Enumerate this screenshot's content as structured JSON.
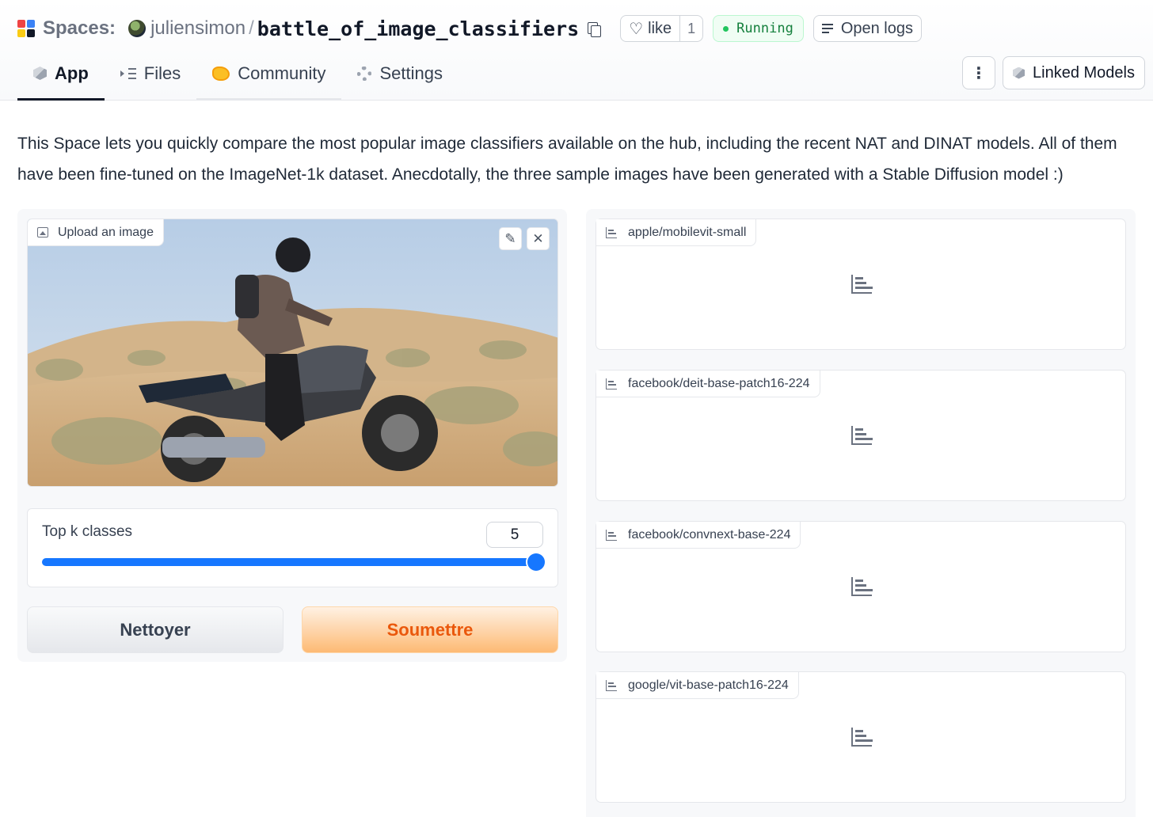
{
  "header": {
    "spaces_label": "Spaces:",
    "owner": "juliensimon",
    "separator": "/",
    "repo": "battle_of_image_classifiers",
    "like_label": "like",
    "like_count": "1",
    "status": "Running",
    "logs_label": "Open logs",
    "linked_models": "Linked Models",
    "kebab": "⋮"
  },
  "tabs": [
    {
      "label": "App"
    },
    {
      "label": "Files"
    },
    {
      "label": "Community"
    },
    {
      "label": "Settings"
    }
  ],
  "description": "This Space lets you quickly compare the most popular image classifiers available on the hub, including the recent NAT and DINAT models. All of them have been fine-tuned on the ImageNet-1k dataset. Anecdotally, the three sample images have been generated with a Stable Diffusion model :)",
  "input": {
    "upload_label": "Upload an image",
    "edit_icon": "✎",
    "close_icon": "✕"
  },
  "slider": {
    "label": "Top k classes",
    "value": "5",
    "fraction": 1.0
  },
  "buttons": {
    "clear": "Nettoyer",
    "submit": "Soumettre"
  },
  "results": [
    {
      "label": "apple/mobilevit-small"
    },
    {
      "label": "facebook/deit-base-patch16-224"
    },
    {
      "label": "facebook/convnext-base-224"
    },
    {
      "label": "google/vit-base-patch16-224"
    }
  ],
  "colors": {
    "accent_blue": "#1677ff",
    "submit_orange": "#ea580c",
    "running_green": "#15803d"
  },
  "icons": {
    "logo": "spaces-logo-icon",
    "copy": "copy-icon",
    "heart": "heart-icon",
    "logs": "logs-icon",
    "chart": "bar-chart-icon"
  }
}
